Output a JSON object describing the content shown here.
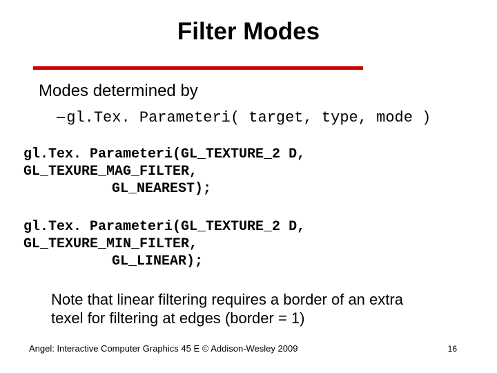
{
  "title": "Filter Modes",
  "heading": "Modes determined by",
  "sub_dash": "–",
  "sub_code": "gl.Tex. Parameteri( target, type, mode )",
  "code1_line1": "gl.Tex. Parameteri(GL_TEXTURE_2 D, GL_TEXURE_MAG_FILTER,",
  "code1_line2": "GL_NEAREST);",
  "code2_line1": "gl.Tex. Parameteri(GL_TEXTURE_2 D, GL_TEXURE_MIN_FILTER,",
  "code2_line2": "GL_LINEAR);",
  "note": "Note that linear filtering requires a border of an extra texel for filtering at edges (border = 1)",
  "footer_left": "Angel: Interactive Computer Graphics 45 E © Addison-Wesley 2009",
  "page_number": "16"
}
